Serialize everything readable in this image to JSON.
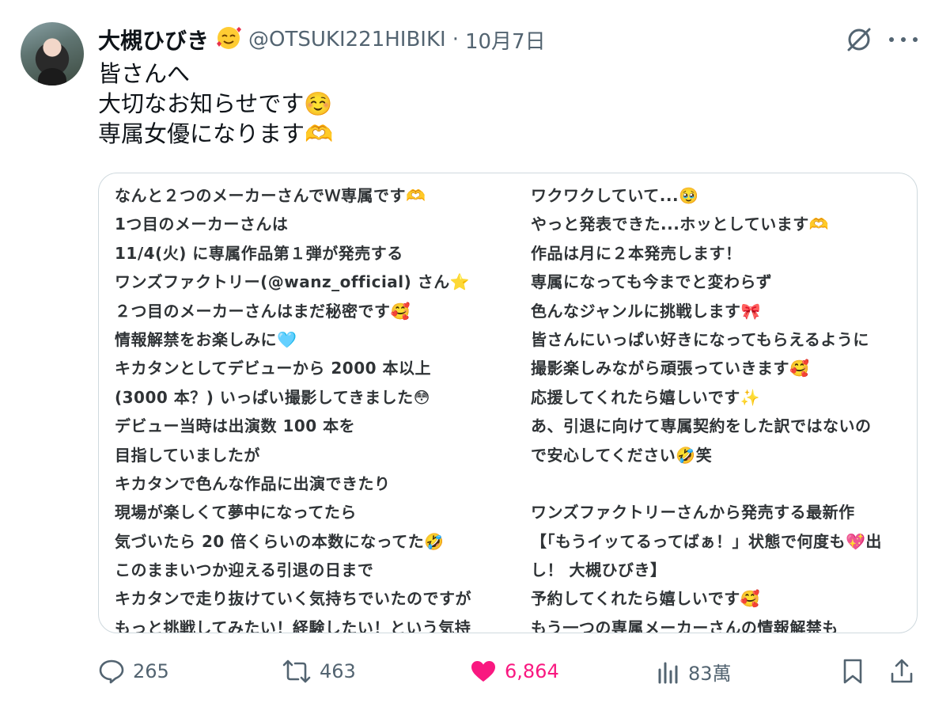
{
  "author": {
    "name": "大槻ひびき",
    "name_emoji": "🥰",
    "handle": "@OTSUKI221HIBIKI",
    "separator": "·",
    "date": "10月7日"
  },
  "tweet_lines": [
    "皆さんへ",
    "大切なお知らせです☺️",
    "専属女優になります🫶"
  ],
  "card": {
    "left_lines": [
      "なんと２つのメーカーさんでＷ専属です🫶",
      "1つ目のメーカーさんは",
      "11/4(火) に専属作品第１弾が発売する",
      "ワンズファクトリー(@wanz_official) さん⭐",
      "２つ目のメーカーさんはまだ秘密です🥰",
      "情報解禁をお楽しみに🩵",
      "キカタンとしてデビューから 2000 本以上",
      "(3000 本？) いっぱい撮影してきました😳",
      "デビュー当時は出演数 100 本を",
      "目指していましたが",
      "キカタンで色んな作品に出演できたり",
      "現場が楽しくて夢中になってたら",
      "気づいたら 20 倍くらいの本数になってた🤣",
      "このままいつか迎える引退の日まで",
      "キカタンで走り抜けていく気持ちでいたのですが",
      "もっと挑戦してみたい！経験したい！という気持"
    ],
    "right_lines_a": [
      "ワクワクしていて...🥹",
      "やっと発表できた...ホッとしています🫶",
      "作品は月に２本発売します！",
      "専属になっても今までと変わらず",
      "色んなジャンルに挑戦します🎀",
      "皆さんにいっぱい好きになってもらえるように",
      "撮影楽しみながら頑張っていきます🥰",
      "応援してくれたら嬉しいです✨",
      "あ、引退に向けて専属契約をした訳ではないの",
      "で安心してください🤣笑"
    ],
    "right_lines_b": [
      "ワンズファクトリーさんから発売する最新作",
      "【「もうイッてるってばぁ！」状態で何度も💖出",
      "し！ 大槻ひびき】",
      "予約してくれたら嬉しいです🥰",
      "もう一つの専属メーカーさんの情報解禁も"
    ]
  },
  "actions": {
    "replies": "265",
    "retweets": "463",
    "likes": "6,864",
    "views": "83萬"
  },
  "colors": {
    "like": "#f91880",
    "muted": "#536471"
  }
}
